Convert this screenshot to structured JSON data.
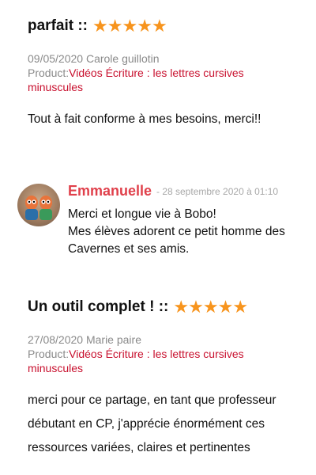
{
  "review1": {
    "title": "parfait ::",
    "rating": 5,
    "date_author": "09/05/2020 Carole guillotin",
    "product_prefix": "Product:",
    "product_name": "Vidéos Écriture : les lettres cursives minuscules",
    "text": "Tout à fait conforme à mes besoins, merci!!"
  },
  "reply": {
    "name": "Emmanuelle",
    "date": "- 28 septembre 2020 à 01:10",
    "line1": "Merci et longue vie à Bobo!",
    "line2": "Mes élèves adorent ce petit homme des Cavernes et ses amis."
  },
  "review2": {
    "title": "Un outil complet ! ::",
    "rating": 5,
    "date_author": "27/08/2020 Marie paire",
    "product_prefix": "Product:",
    "product_name": "Vidéos Écriture : les lettres cursives minuscules",
    "text": "merci pour ce partage, en tant que professeur débutant en CP, j'apprécie énormément ces ressources variées, claires et pertinentes"
  },
  "colors": {
    "star": "#f7941d",
    "link": "#c8102e",
    "reply_name": "#e0404b"
  }
}
